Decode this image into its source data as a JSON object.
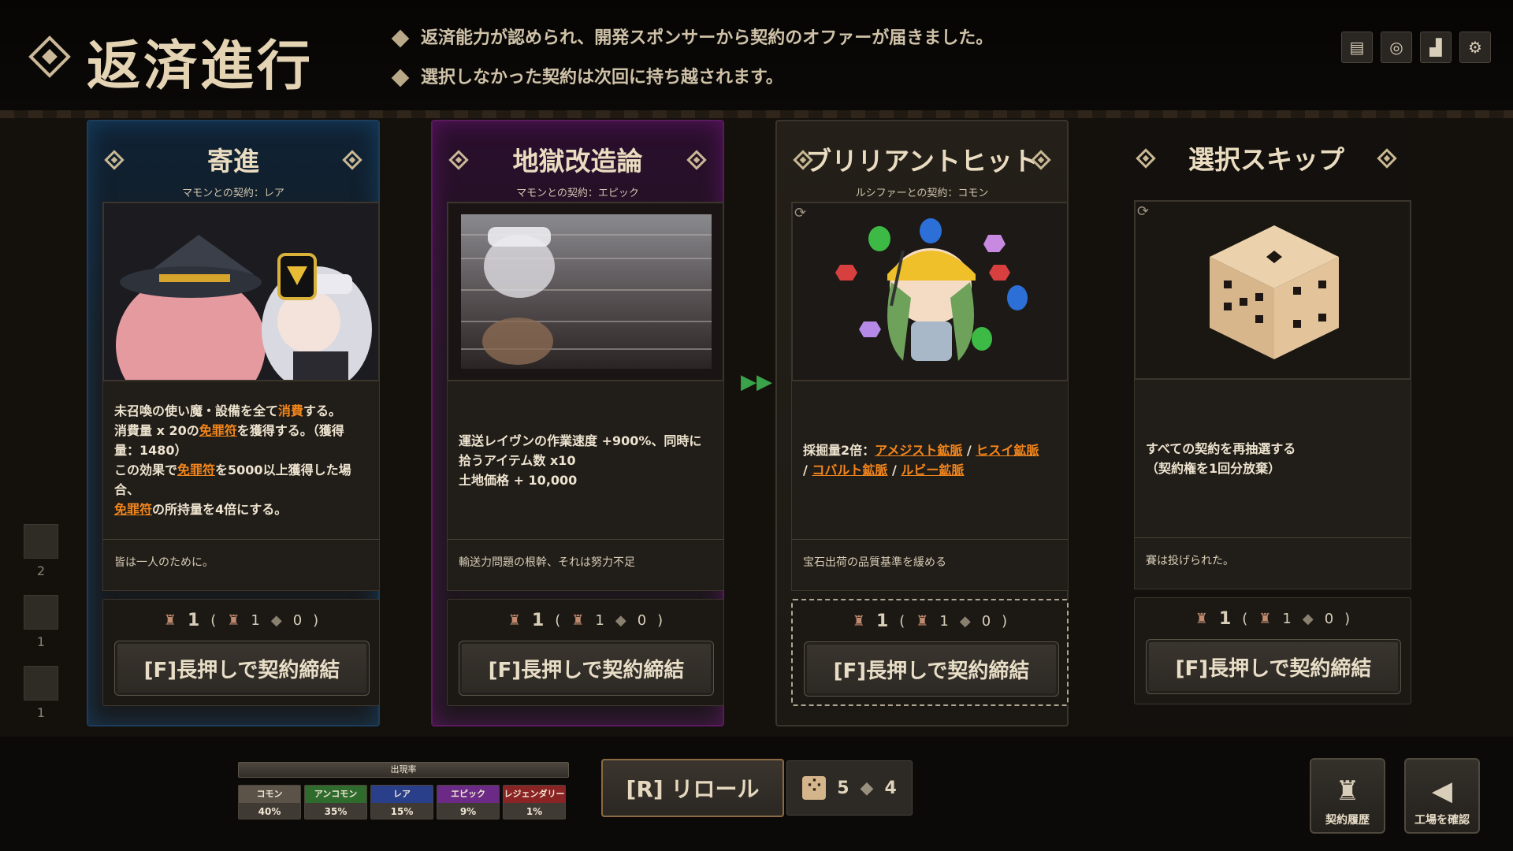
{
  "header": {
    "title": "返済進行",
    "notices": [
      "返済能力が認められ、開発スポンサーから契約のオファーが届きました。",
      "選択しなかった契約は次回に持ち越されます。"
    ],
    "icons": [
      "book-icon",
      "target-icon",
      "stats-icon",
      "gear-icon"
    ]
  },
  "side": {
    "counts": [
      "2",
      "1",
      "1"
    ]
  },
  "cards": [
    {
      "title": "寄進",
      "subtitle": "マモンとの契約：レア",
      "rarity": "rare",
      "art": "demon-and-girl-illustration",
      "desc_lines": [
        [
          "未召喚の使い魔・設備を全て",
          "消費",
          "する。"
        ],
        [
          "消費量 x 20の",
          "免罪符",
          "を獲得する。（獲得量：1480）"
        ],
        [
          "この効果で",
          "免罪符",
          "を5000以上獲得した場合、"
        ],
        [
          "",
          "免罪符",
          "の所持量を4倍にする。"
        ]
      ],
      "flavor": "皆は一人のために。",
      "cost": "1",
      "cost_detail_a": "1",
      "cost_detail_b": "0",
      "button": "[F]長押しで契約締結"
    },
    {
      "title": "地獄改造論",
      "subtitle": "マモンとの契約：エピック",
      "rarity": "epic",
      "art": "speeding-courier-illustration",
      "desc": "運送レイヴンの作業速度 +900%、同時に拾うアイテム数 x10",
      "desc2": "土地価格 + 10,000",
      "flavor": "輸送力問題の根幹、それは努力不足",
      "cost": "1",
      "cost_detail_a": "1",
      "cost_detail_b": "0",
      "button": "[F]長押しで契約締結"
    },
    {
      "title": "ブリリアントヒット",
      "subtitle": "ルシファーとの契約：コモン",
      "rarity": "common",
      "art": "miner-with-gems-illustration",
      "desc_prefix": "採掘量2倍：",
      "links": [
        "アメジスト鉱脈",
        "ヒスイ鉱脈",
        "コバルト鉱脈",
        "ルビー鉱脈"
      ],
      "flavor": "宝石出荷の品質基準を緩める",
      "cost": "1",
      "cost_detail_a": "1",
      "cost_detail_b": "0",
      "button": "[F]長押しで契約締結"
    },
    {
      "title": "選択スキップ",
      "subtitle": "",
      "rarity": "skip",
      "art": "dice-illustration",
      "desc": "すべての契約を再抽選する",
      "desc2": "（契約権を1回分放棄）",
      "flavor": "賽は投げられた。",
      "cost": "1",
      "cost_detail_a": "1",
      "cost_detail_b": "0",
      "button": "[F]長押しで契約締結"
    }
  ],
  "rates": {
    "title": "出現率",
    "items": [
      {
        "name": "コモン",
        "value": "40%",
        "color": "#5b5348"
      },
      {
        "name": "アンコモン",
        "value": "35%",
        "color": "#2f6b2c"
      },
      {
        "name": "レア",
        "value": "15%",
        "color": "#2a3f8a"
      },
      {
        "name": "エピック",
        "value": "9%",
        "color": "#6a2a86"
      },
      {
        "name": "レジェンダリー",
        "value": "1%",
        "color": "#8a2424"
      }
    ]
  },
  "reroll": {
    "label": "[R] リロール",
    "from": "5",
    "to": "4"
  },
  "buttons": {
    "history": "契約履歴",
    "factory": "工場を確認"
  }
}
